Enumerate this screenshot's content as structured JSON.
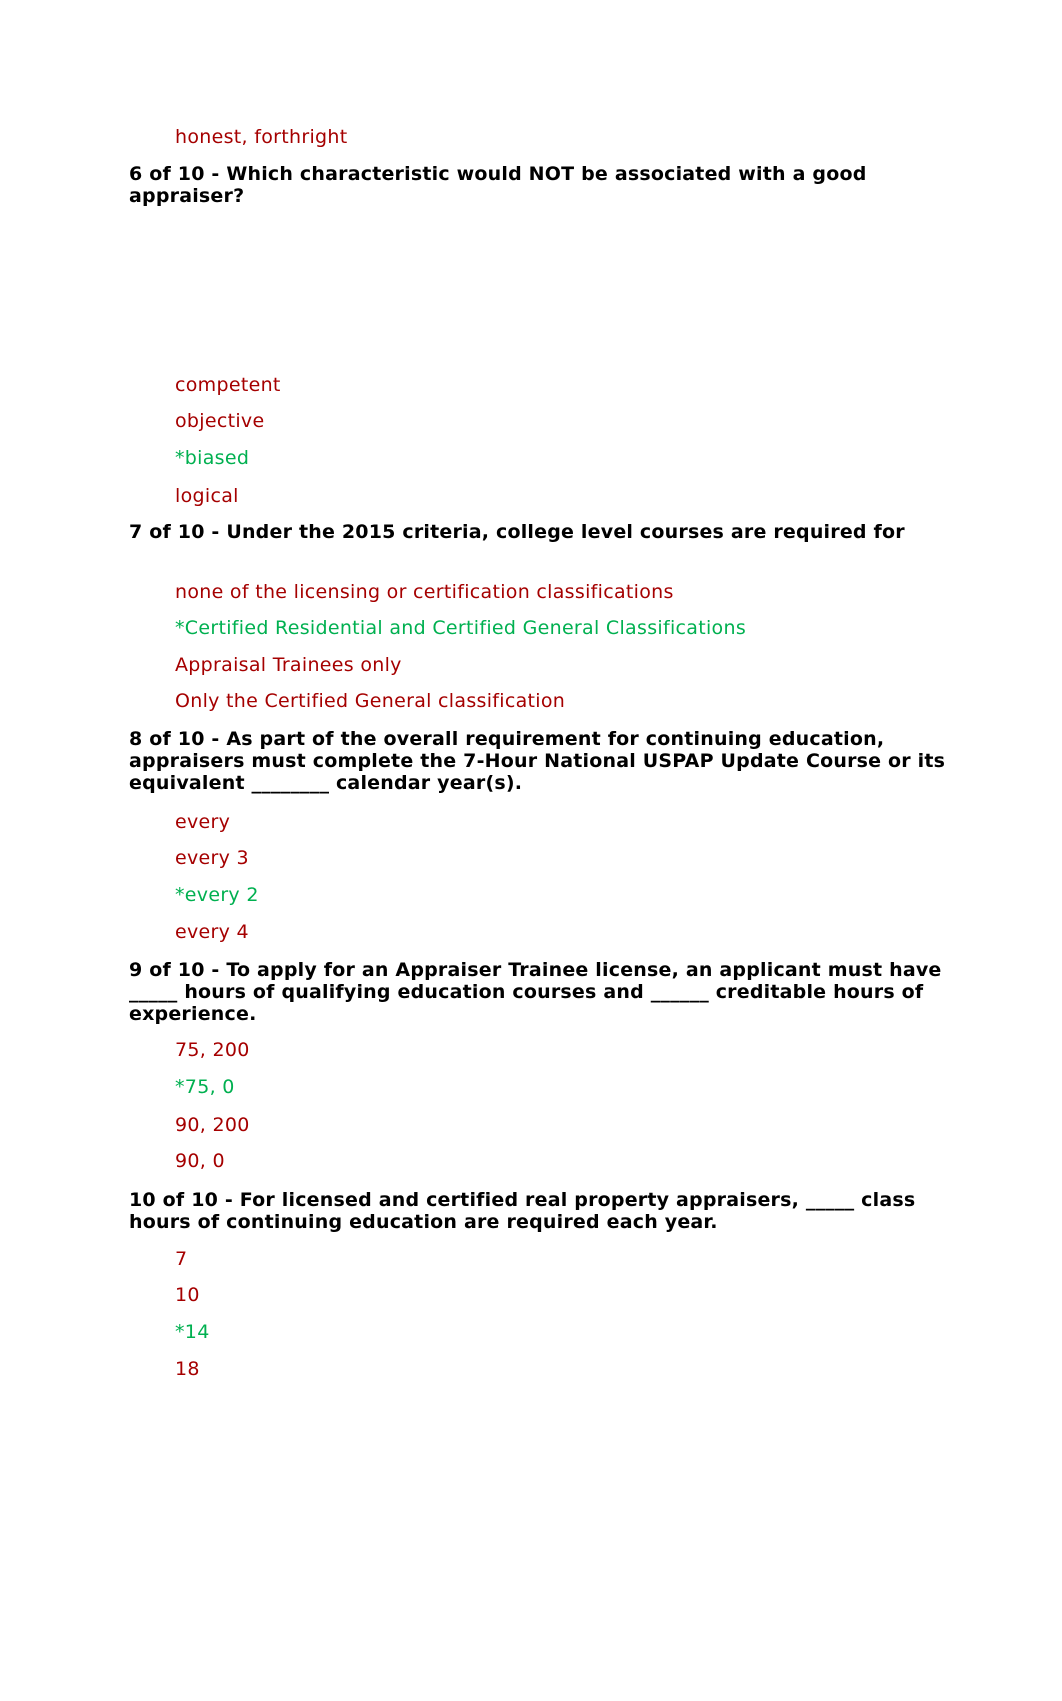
{
  "colors": {
    "incorrect": "#a50000",
    "correct": "#00b050",
    "question": "#000000"
  },
  "leading_answer": {
    "text": "honest, forthright",
    "correct": false
  },
  "questions": [
    {
      "text": "6 of 10 - Which characteristic would NOT be associated with a good appraiser?",
      "answers": [
        {
          "text": "competent",
          "correct": false
        },
        {
          "text": "objective",
          "correct": false
        },
        {
          "text": "*biased",
          "correct": true
        },
        {
          "text": "logical",
          "correct": false
        }
      ]
    },
    {
      "text": "7 of 10 - Under the 2015 criteria, college level courses are required for",
      "answers": [
        {
          "text": "none of the licensing or certification classifications",
          "correct": false
        },
        {
          "text": "*Certified Residential and Certified General Classifications",
          "correct": true
        },
        {
          "text": "Appraisal Trainees only",
          "correct": false
        },
        {
          "text": "Only the Certified General classification",
          "correct": false
        }
      ]
    },
    {
      "text": "8 of 10 - As part of the overall requirement for continuing education, appraisers must complete the 7-Hour National USPAP Update Course or its equivalent ________ calendar year(s).",
      "answers": [
        {
          "text": "every",
          "correct": false
        },
        {
          "text": "every 3",
          "correct": false
        },
        {
          "text": "*every 2",
          "correct": true
        },
        {
          "text": "every 4",
          "correct": false
        }
      ]
    },
    {
      "text": "9 of 10 - To apply for an Appraiser Trainee license, an applicant must have _____ hours of qualifying education courses and ______ creditable hours of experience.",
      "answers": [
        {
          "text": "75, 200",
          "correct": false
        },
        {
          "text": "*75, 0",
          "correct": true
        },
        {
          "text": "90, 200",
          "correct": false
        },
        {
          "text": "90, 0",
          "correct": false
        }
      ]
    },
    {
      "text": "10 of 10 - For licensed and certified real property appraisers, _____ class hours of continuing education are required each year.",
      "answers": [
        {
          "text": "7",
          "correct": false
        },
        {
          "text": "10",
          "correct": false
        },
        {
          "text": "*14",
          "correct": true
        },
        {
          "text": "18",
          "correct": false
        }
      ]
    }
  ]
}
